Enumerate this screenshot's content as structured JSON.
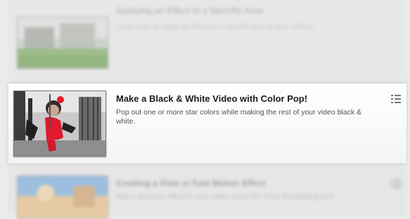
{
  "lessons": {
    "previous": {
      "title": "Applying an Effect to a Specific Area",
      "description": "Learn how to apply an effect to a specific part of your videos."
    },
    "current": {
      "title": "Make a Black & White Video with Color Pop!",
      "description": "Pop out one or more star colors while making the rest of your video black & white.",
      "icon": "list-icon"
    },
    "next": {
      "title": "Creating a Slow or Fast Motion Effect",
      "description": "Add a dynamic effect to your video using the Time Remapping tool.",
      "icon": "list-icon"
    }
  }
}
